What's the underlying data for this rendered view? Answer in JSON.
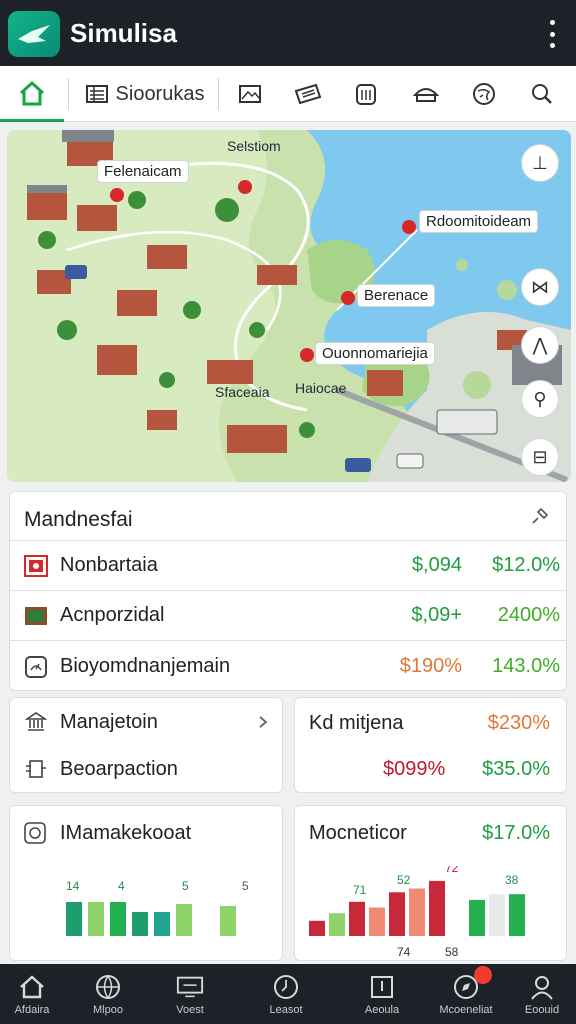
{
  "app": {
    "title": "Simulisa"
  },
  "tabs": [
    {
      "icon": "home-icon",
      "label": ""
    },
    {
      "icon": "list-icon",
      "label": "Sioorukas"
    },
    {
      "icon": "image-icon",
      "label": ""
    },
    {
      "icon": "ticket-icon",
      "label": ""
    },
    {
      "icon": "building-icon",
      "label": ""
    },
    {
      "icon": "cart-icon",
      "label": ""
    },
    {
      "icon": "globe-icon",
      "label": ""
    },
    {
      "icon": "search-icon",
      "label": ""
    }
  ],
  "map": {
    "labels": {
      "top": "Selstiom",
      "nw": "Felenaicam",
      "ne": "Rdoomitoideam",
      "center": "Berenace",
      "south": "Ouonnomariejia",
      "town_left": "Sfaceaia",
      "town_mid": "Haiocae"
    },
    "controls": [
      "compass-icon",
      "layers-icon",
      "navigate-icon",
      "pin-icon",
      "bookmark-icon"
    ]
  },
  "summary": {
    "title": "Mandnesfai",
    "rows": [
      {
        "icon": "flag-icon",
        "label": "Nonbartaia",
        "v1": "$,094",
        "v1_color": "green",
        "v2": "$12.0%",
        "v2_color": "green"
      },
      {
        "icon": "crate-icon",
        "label": "Acnporzidal",
        "v1": "$,09+",
        "v1_color": "green",
        "v2": "2400%",
        "v2_color": "lime"
      },
      {
        "icon": "gauge-icon",
        "label": "Bioyomdnanjemain",
        "v1": "$190%",
        "v1_color": "orange",
        "v2": "143.0%",
        "v2_color": "lime"
      }
    ]
  },
  "left_card": {
    "rows": [
      {
        "icon": "bank-icon",
        "label": "Manajetoin"
      },
      {
        "icon": "transfer-icon",
        "label": "Beoarpaction"
      }
    ]
  },
  "right_card": {
    "row1": {
      "label": "Kd mitjena",
      "value": "$230%",
      "color": "orange"
    },
    "row2": {
      "value": "$099%",
      "value2": "$35.0%"
    }
  },
  "chart_left": {
    "title": "IMamakekooat",
    "top_value": ""
  },
  "chart_right": {
    "title": "Mocneticor",
    "top_value": "$17.0%"
  },
  "chart_data": [
    {
      "type": "bar",
      "title": "IMamakekooat",
      "series": [
        {
          "values": [
            34,
            34,
            34,
            24,
            24,
            32,
            20,
            30
          ]
        }
      ],
      "annotations": [
        "14",
        "4",
        "5",
        "5"
      ]
    },
    {
      "type": "bar",
      "title": "Mocneticor",
      "series": [
        {
          "values": [
            16,
            24,
            36,
            30,
            46,
            50,
            58,
            0,
            38,
            44,
            44
          ]
        }
      ],
      "annotations": [
        "71",
        "52",
        "72",
        "38",
        "74",
        "58"
      ]
    }
  ],
  "nav": [
    {
      "icon": "home-icon",
      "label": "Afdaira"
    },
    {
      "icon": "globe-icon",
      "label": "Mlpoo"
    },
    {
      "icon": "monitor-icon",
      "label": "Voest"
    },
    {
      "icon": "clock-icon",
      "label": "Leasot"
    },
    {
      "icon": "box-icon",
      "label": "Aeoula"
    },
    {
      "icon": "compass-icon",
      "label": "Mcoeneliat"
    },
    {
      "icon": "user-icon",
      "label": "Eoouid"
    }
  ],
  "colors": {
    "accent": "#16a34a",
    "bar_dark": "#1f9d6e",
    "bar_light": "#8fd36a",
    "bar_red": "#c7283a",
    "bar_salmon": "#f08a74"
  }
}
